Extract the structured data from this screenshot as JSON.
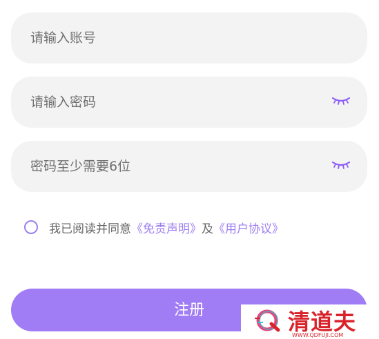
{
  "form": {
    "account": {
      "placeholder": "请输入账号",
      "value": ""
    },
    "password": {
      "placeholder": "请输入密码",
      "value": ""
    },
    "password_hint": {
      "placeholder": "密码至少需要6位",
      "value": ""
    }
  },
  "agreement": {
    "prefix": "我已阅读并同意",
    "disclaimer_link": "《免责声明》",
    "connector": "及",
    "user_agreement_link": "《用户协议》"
  },
  "register_button": {
    "label": "注册"
  },
  "watermark": {
    "name": "清道夫",
    "url": "WWW.QDFUJI.COM"
  },
  "colors": {
    "accent": "#a07cf5",
    "link": "#9b7ef0",
    "field_bg": "#f3f3f3",
    "watermark": "#d8232a"
  },
  "icons": {
    "password_toggle": "eye-closed-icon",
    "agreement_checkbox": "radio-circle-icon",
    "watermark_logo": "q-logo-icon"
  }
}
